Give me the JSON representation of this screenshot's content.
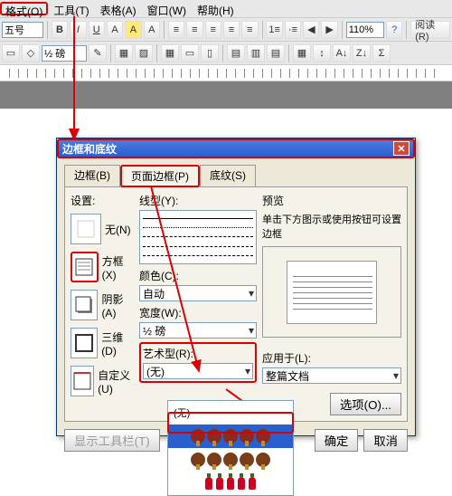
{
  "menubar": {
    "format": "格式(O)",
    "tools": "工具(T)",
    "table": "表格(A)",
    "window": "窗口(W)",
    "help": "帮助(H)"
  },
  "toolbar1": {
    "fontsize": "五号",
    "zoom": "110%",
    "read": "阅读(R)"
  },
  "toolbar2": {
    "lineheight": "½ 磅"
  },
  "dialog": {
    "title": "边框和底纹",
    "tabs": {
      "border": "边框(B)",
      "page": "页面边框(P)",
      "shading": "底纹(S)"
    },
    "setting_label": "设置:",
    "settings": {
      "none": "无(N)",
      "box": "方框(X)",
      "shadow": "阴影(A)",
      "threeD": "三维(D)",
      "custom": "自定义(U)"
    },
    "style_label": "线型(Y):",
    "color_label": "颜色(C):",
    "color_value": "自动",
    "width_label": "宽度(W):",
    "width_value": "½ 磅",
    "art_label": "艺术型(R):",
    "art_value": "(无)",
    "preview_label": "预览",
    "preview_hint": "单击下方图示或使用按钮可设置边框",
    "applyto_label": "应用于(L):",
    "applyto_value": "整篇文档",
    "options": "选项(O)...",
    "show_toolbar": "显示工具栏(T)",
    "ok": "确定",
    "cancel": "取消"
  }
}
